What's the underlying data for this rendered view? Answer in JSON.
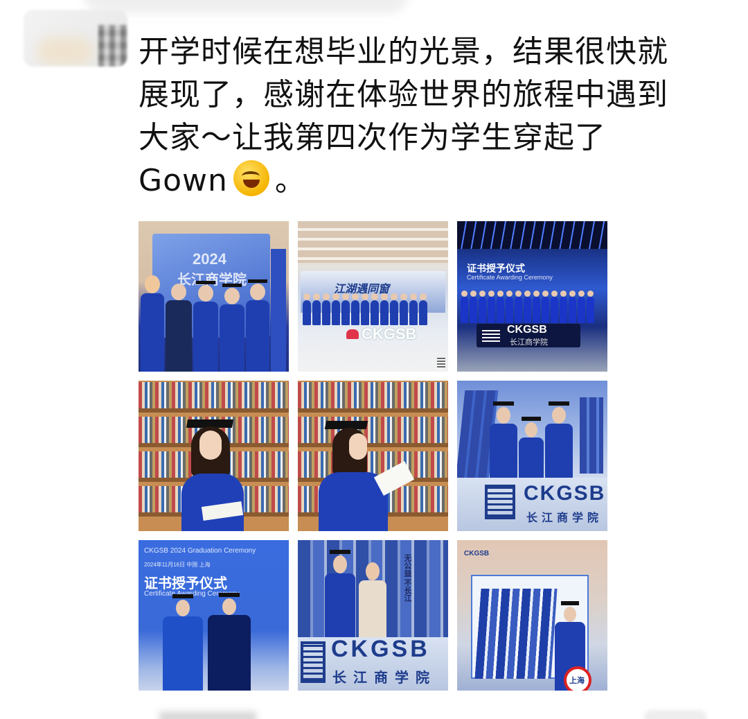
{
  "post": {
    "lines": [
      "开学时候在想毕业的光景，结果很快就",
      "展现了，感谢在体验世界的旅程中遇到",
      "大家～让我第四次作为学生穿起了"
    ],
    "last_line_prefix": "Gown",
    "emoji_name": "rolling-on-floor-laughing-emoji",
    "last_line_suffix": "。"
  },
  "photos": [
    {
      "id": "p1",
      "caption_year": "2024",
      "caption_school": "长江商学院"
    },
    {
      "id": "p2",
      "banner_text": "江湖遇同窗",
      "brand": "CKGSB"
    },
    {
      "id": "p3",
      "title": "证书授予仪式",
      "subtitle": "Certificate Awarding Ceremony",
      "brand": "CKGSB",
      "brand_cn": "长江商学院"
    },
    {
      "id": "p4"
    },
    {
      "id": "p5"
    },
    {
      "id": "p6",
      "brand": "CKGSB",
      "brand_cn": "长江商学院"
    },
    {
      "id": "p7",
      "header": "CKGSB 2024 Graduation Ceremony",
      "date_line": "2024年11月16日 中国 上海",
      "title": "证书授予仪式",
      "subtitle": "Certificate Awarding Ceremony"
    },
    {
      "id": "p8",
      "book_text": "无公益 不长江",
      "brand": "CKGSB",
      "brand_cn": "长江商学院"
    },
    {
      "id": "p9",
      "corner_logo": "CKGSB",
      "sign": "上海"
    }
  ],
  "colors": {
    "ckgsb_blue": "#1e3c8c",
    "gown_blue": "#1f3fb0",
    "text": "#111111"
  }
}
